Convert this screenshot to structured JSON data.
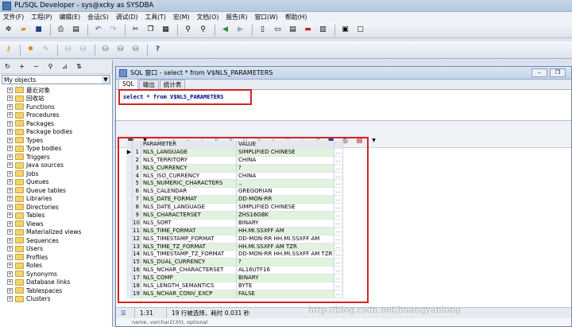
{
  "window": {
    "title": "PL/SQL Developer - sys@xcky as SYSDBA"
  },
  "menu": [
    "文件(F)",
    "工程(P)",
    "编辑(E)",
    "会话(S)",
    "调试(D)",
    "工具(T)",
    "宏(M)",
    "文档(O)",
    "报告(R)",
    "窗口(W)",
    "帮助(H)"
  ],
  "object_browser": {
    "filter": "My objects",
    "items": [
      "最近对象",
      "回收站",
      "Functions",
      "Procedures",
      "Packages",
      "Package bodies",
      "Types",
      "Type bodies",
      "Triggers",
      "Java sources",
      "Jobs",
      "Queues",
      "Queue tables",
      "Libraries",
      "Directories",
      "Tables",
      "Views",
      "Materialized views",
      "Sequences",
      "Users",
      "Profiles",
      "Roles",
      "Synonyms",
      "Database links",
      "Tablespaces",
      "Clusters"
    ]
  },
  "sql_window": {
    "title": "SQL 窗口 - select * from V$NLS_PARAMETERS",
    "tabs": [
      "SQL",
      "输出",
      "统计表"
    ],
    "query": "select * from V$NLS_PARAMETERS"
  },
  "grid": {
    "columns": [
      "PARAMETER",
      "VALUE"
    ],
    "rows": [
      {
        "n": "1",
        "param": "NLS_LANGUAGE",
        "value": "SIMPLIFIED CHINESE"
      },
      {
        "n": "2",
        "param": "NLS_TERRITORY",
        "value": "CHINA"
      },
      {
        "n": "3",
        "param": "NLS_CURRENCY",
        "value": "?"
      },
      {
        "n": "4",
        "param": "NLS_ISO_CURRENCY",
        "value": "CHINA"
      },
      {
        "n": "5",
        "param": "NLS_NUMERIC_CHARACTERS",
        "value": ".,"
      },
      {
        "n": "6",
        "param": "NLS_CALENDAR",
        "value": "GREGORIAN"
      },
      {
        "n": "7",
        "param": "NLS_DATE_FORMAT",
        "value": "DD-MON-RR"
      },
      {
        "n": "8",
        "param": "NLS_DATE_LANGUAGE",
        "value": "SIMPLIFIED CHINESE"
      },
      {
        "n": "9",
        "param": "NLS_CHARACTERSET",
        "value": "ZHS16GBK"
      },
      {
        "n": "10",
        "param": "NLS_SORT",
        "value": "BINARY"
      },
      {
        "n": "11",
        "param": "NLS_TIME_FORMAT",
        "value": "HH.MI.SSXFF AM"
      },
      {
        "n": "12",
        "param": "NLS_TIMESTAMP_FORMAT",
        "value": "DD-MON-RR HH.MI.SSXFF AM"
      },
      {
        "n": "13",
        "param": "NLS_TIME_TZ_FORMAT",
        "value": "HH.MI.SSXFF AM TZR"
      },
      {
        "n": "14",
        "param": "NLS_TIMESTAMP_TZ_FORMAT",
        "value": "DD-MON-RR HH.MI.SSXFF AM TZR"
      },
      {
        "n": "15",
        "param": "NLS_DUAL_CURRENCY",
        "value": "?"
      },
      {
        "n": "16",
        "param": "NLS_NCHAR_CHARACTERSET",
        "value": "AL16UTF16"
      },
      {
        "n": "17",
        "param": "NLS_COMP",
        "value": "BINARY"
      },
      {
        "n": "18",
        "param": "NLS_LENGTH_SEMANTICS",
        "value": "BYTE"
      },
      {
        "n": "19",
        "param": "NLS_NCHAR_CONV_EXCP",
        "value": "FALSE"
      }
    ],
    "cell_button": "..."
  },
  "status": {
    "position": "1:31",
    "message": "19 行被选择，耗时 0.031 秒"
  },
  "bottom_text": "name, varchar2(30), optional",
  "watermark": "http://blog.csdn.net/huangyanlong",
  "colors": {
    "highlight": "#d62222",
    "row_alt": "#e2f2dd",
    "sql_text": "#00008b"
  }
}
